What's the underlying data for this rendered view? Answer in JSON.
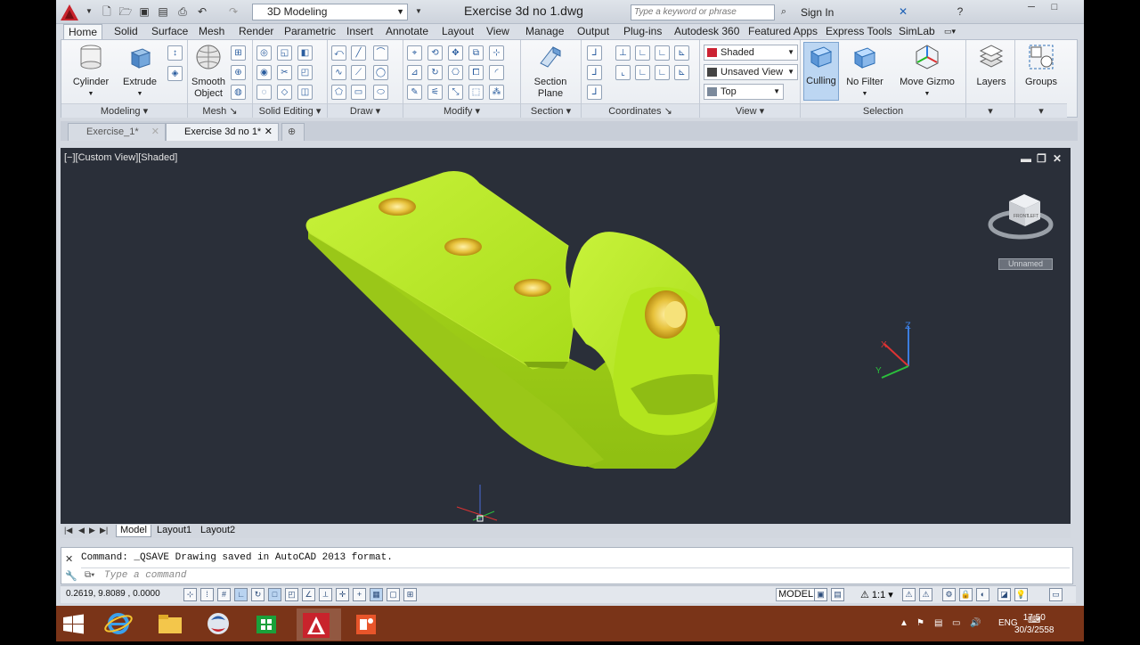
{
  "titlebar": {
    "workspace": "3D Modeling",
    "title": "Exercise 3d no 1.dwg",
    "search_placeholder": "Type a keyword or phrase",
    "signin": "Sign In"
  },
  "tabs": [
    "Home",
    "Solid",
    "Surface",
    "Mesh",
    "Render",
    "Parametric",
    "Insert",
    "Annotate",
    "Layout",
    "View",
    "Manage",
    "Output",
    "Plug-ins",
    "Autodesk 360",
    "Featured Apps",
    "Express Tools",
    "SimLab"
  ],
  "ribbon": {
    "modeling": {
      "title": "Modeling",
      "cylinder": "Cylinder",
      "extrude": "Extrude"
    },
    "mesh": {
      "title": "Mesh",
      "smooth_object_1": "Smooth",
      "smooth_object_2": "Object"
    },
    "solid_editing": {
      "title": "Solid Editing"
    },
    "draw": {
      "title": "Draw"
    },
    "modify": {
      "title": "Modify"
    },
    "section": {
      "title": "Section",
      "section_plane_1": "Section",
      "section_plane_2": "Plane"
    },
    "coordinates": {
      "title": "Coordinates"
    },
    "view": {
      "title": "View",
      "visual_style": "Shaded",
      "named_view": "Unsaved View",
      "view_dir": "Top"
    },
    "selection": {
      "title": "Selection",
      "culling": "Culling",
      "no_filter": "No Filter",
      "move_gizmo": "Move Gizmo"
    },
    "layers": "Layers",
    "groups": "Groups"
  },
  "doc_tabs": [
    {
      "label": "Exercise_1*"
    },
    {
      "label": "Exercise 3d no 1*"
    }
  ],
  "viewport": {
    "label": "[−][Custom View][Shaded]",
    "viewcube_label": "Unnamed",
    "model_color": "#b3e51e"
  },
  "layout_tabs": [
    "Model",
    "Layout1",
    "Layout2"
  ],
  "command": {
    "history": "Command: _QSAVE Drawing saved in AutoCAD 2013 format.",
    "placeholder": "Type a command"
  },
  "status": {
    "coords": "0.2619, 9.8089 , 0.0000",
    "model": "MODEL",
    "scale": "1:1"
  },
  "taskbar": {
    "lang": "ENG",
    "time": "17:50",
    "date": "30/3/2558"
  }
}
